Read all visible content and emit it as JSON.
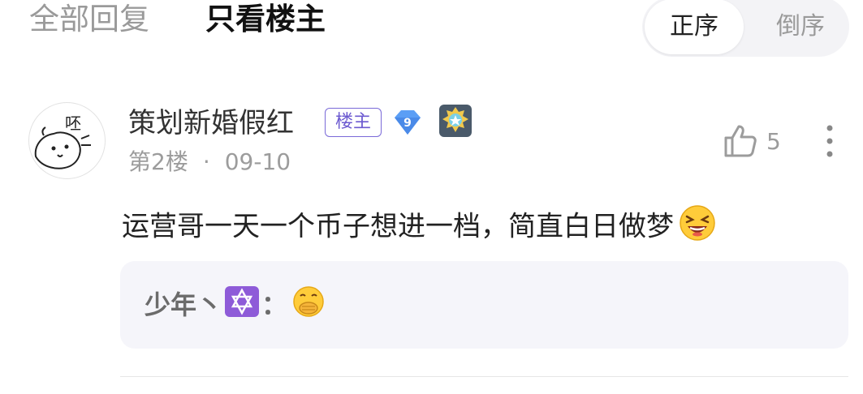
{
  "tabs": {
    "all_replies": "全部回复",
    "op_only": "只看楼主"
  },
  "sort": {
    "ascending": "正序",
    "descending": "倒序"
  },
  "post": {
    "username": "策划新婚假红",
    "op_badge": "楼主",
    "level": "9",
    "floor": "第2楼",
    "separator": "·",
    "date": "09-10",
    "likes": "5",
    "content": "运营哥一天一个币子想进一档，简直白日做梦",
    "avatar_text": "呸"
  },
  "reply": {
    "author": "少年丶",
    "separator": "："
  },
  "icons": {
    "like": "thumbs-up-icon",
    "more": "more-vertical-icon",
    "level": "diamond-level-icon",
    "medal": "medal-badge-icon",
    "content_emoji": "grinning-squint-emoji-icon",
    "reply_emoji": "hand-over-mouth-emoji-icon",
    "reply_symbol": "star-of-david-icon"
  },
  "colors": {
    "accent": "#6c5ad0",
    "level_badge": "#5b9ef5",
    "reply_background": "#f5f5fa",
    "muted_text": "#9c9c9c"
  }
}
